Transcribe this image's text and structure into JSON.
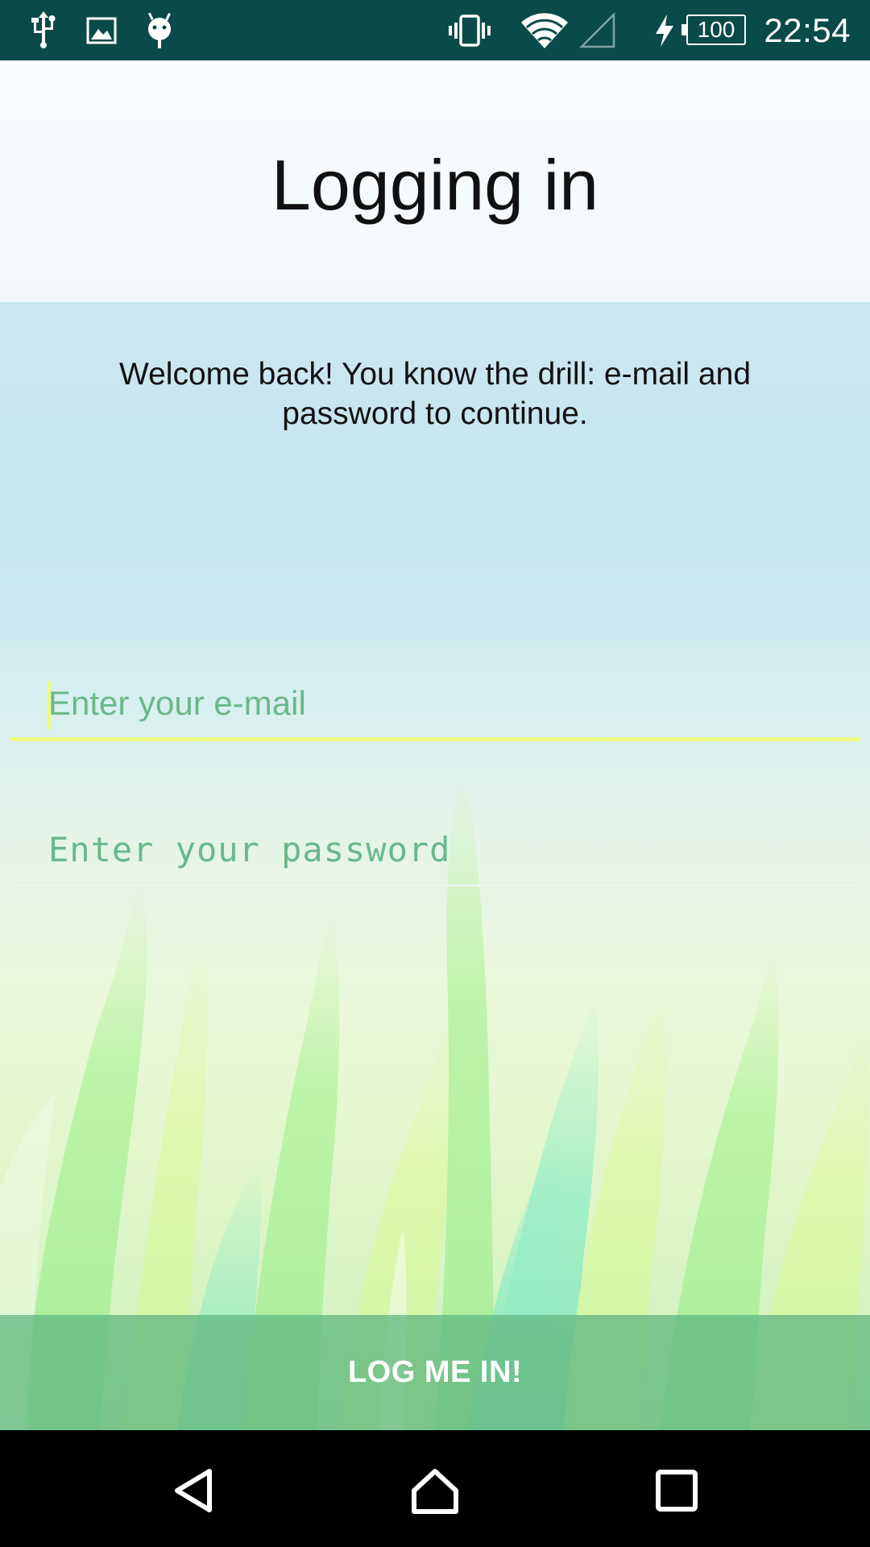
{
  "status_bar": {
    "battery": "100",
    "time": "22:54",
    "icons": [
      "usb-icon",
      "image-icon",
      "android-debug-icon",
      "vibrate-icon",
      "wifi-icon",
      "cell-signal-icon",
      "charging-icon",
      "battery-icon"
    ]
  },
  "header": {
    "title": "Logging in"
  },
  "main": {
    "welcome_text": "Welcome back! You know the drill: e-mail and password to continue.",
    "email": {
      "placeholder": "Enter your e-mail",
      "value": ""
    },
    "password": {
      "placeholder": "Enter your password",
      "value": ""
    },
    "login_button_label": "LOG ME IN!"
  },
  "nav_bar": {
    "icons": [
      "back-icon",
      "home-icon",
      "recents-icon"
    ]
  },
  "colors": {
    "status_bar": "#0b4a4a",
    "accent_yellow": "#eef97f",
    "placeholder_green": "#6ab88a",
    "button": "#64b982"
  }
}
